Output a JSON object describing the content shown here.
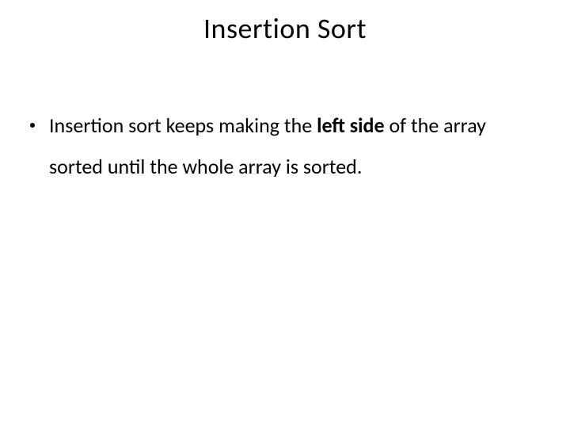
{
  "title": "Insertion Sort",
  "bullets": [
    {
      "pre": "Insertion sort keeps making the ",
      "bold": "left side",
      "post": " of the array sorted until the whole array is sorted."
    }
  ]
}
